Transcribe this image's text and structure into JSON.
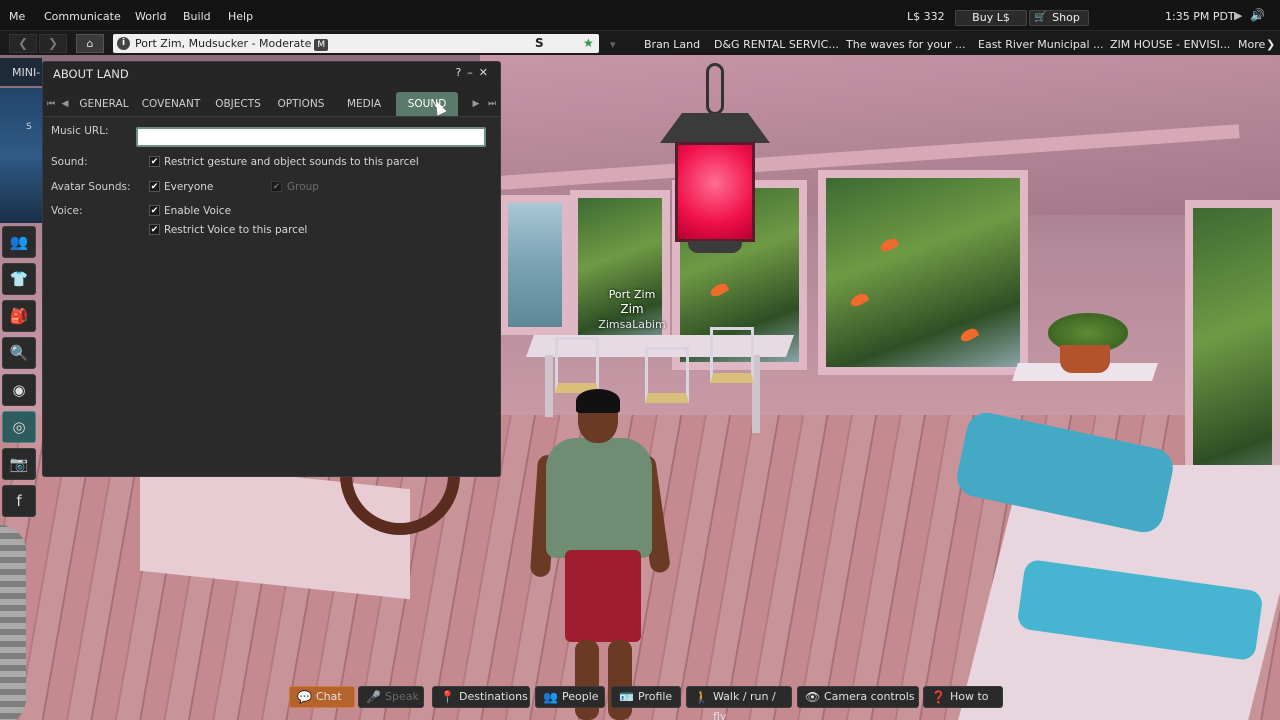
{
  "menubar": {
    "items": [
      "Me",
      "Communicate",
      "World",
      "Build",
      "Help"
    ],
    "balance": "L$ 332",
    "buy_label": "Buy L$",
    "shop_label": "Shop",
    "time": "1:35 PM PDT"
  },
  "navbar": {
    "location": "Port Zim, Mudsucker - Moderate",
    "maturity_badge": "M",
    "favorites": [
      "Bran Land",
      "D&G RENTAL SERVIC...",
      "The waves for your ...",
      "East River Municipal ...",
      "ZIM HOUSE - ENVISI..."
    ],
    "more_label": "More"
  },
  "sidebar": {
    "mini_label": "MINI-",
    "map_letter": "S"
  },
  "floater": {
    "title": "ABOUT LAND",
    "tabs": [
      "GENERAL",
      "COVENANT",
      "OBJECTS",
      "OPTIONS",
      "MEDIA",
      "SOUND"
    ],
    "active_tab": "SOUND",
    "music_url_label": "Music URL:",
    "music_url_value": "",
    "sound_label": "Sound:",
    "sound_restrict": "Restrict gesture and object sounds to this parcel",
    "avatar_sounds_label": "Avatar Sounds:",
    "avatar_sounds_everyone": "Everyone",
    "avatar_sounds_group": "Group",
    "voice_label": "Voice:",
    "voice_enable": "Enable Voice",
    "voice_restrict": "Restrict Voice to this parcel"
  },
  "scene": {
    "nametag_region": "Port Zim",
    "nametag_name": "Zim",
    "nametag_user": "ZimsaLabim"
  },
  "bottombar": {
    "chat": "Chat",
    "speak": "Speak",
    "destinations": "Destinations",
    "people": "People",
    "profile": "Profile",
    "walk": "Walk / run / fly",
    "camera": "Camera controls",
    "howto": "How to"
  },
  "colors": {
    "active_tab": "#5a7a6b",
    "chat_button": "#b5622b",
    "lantern": "#f0104a"
  }
}
